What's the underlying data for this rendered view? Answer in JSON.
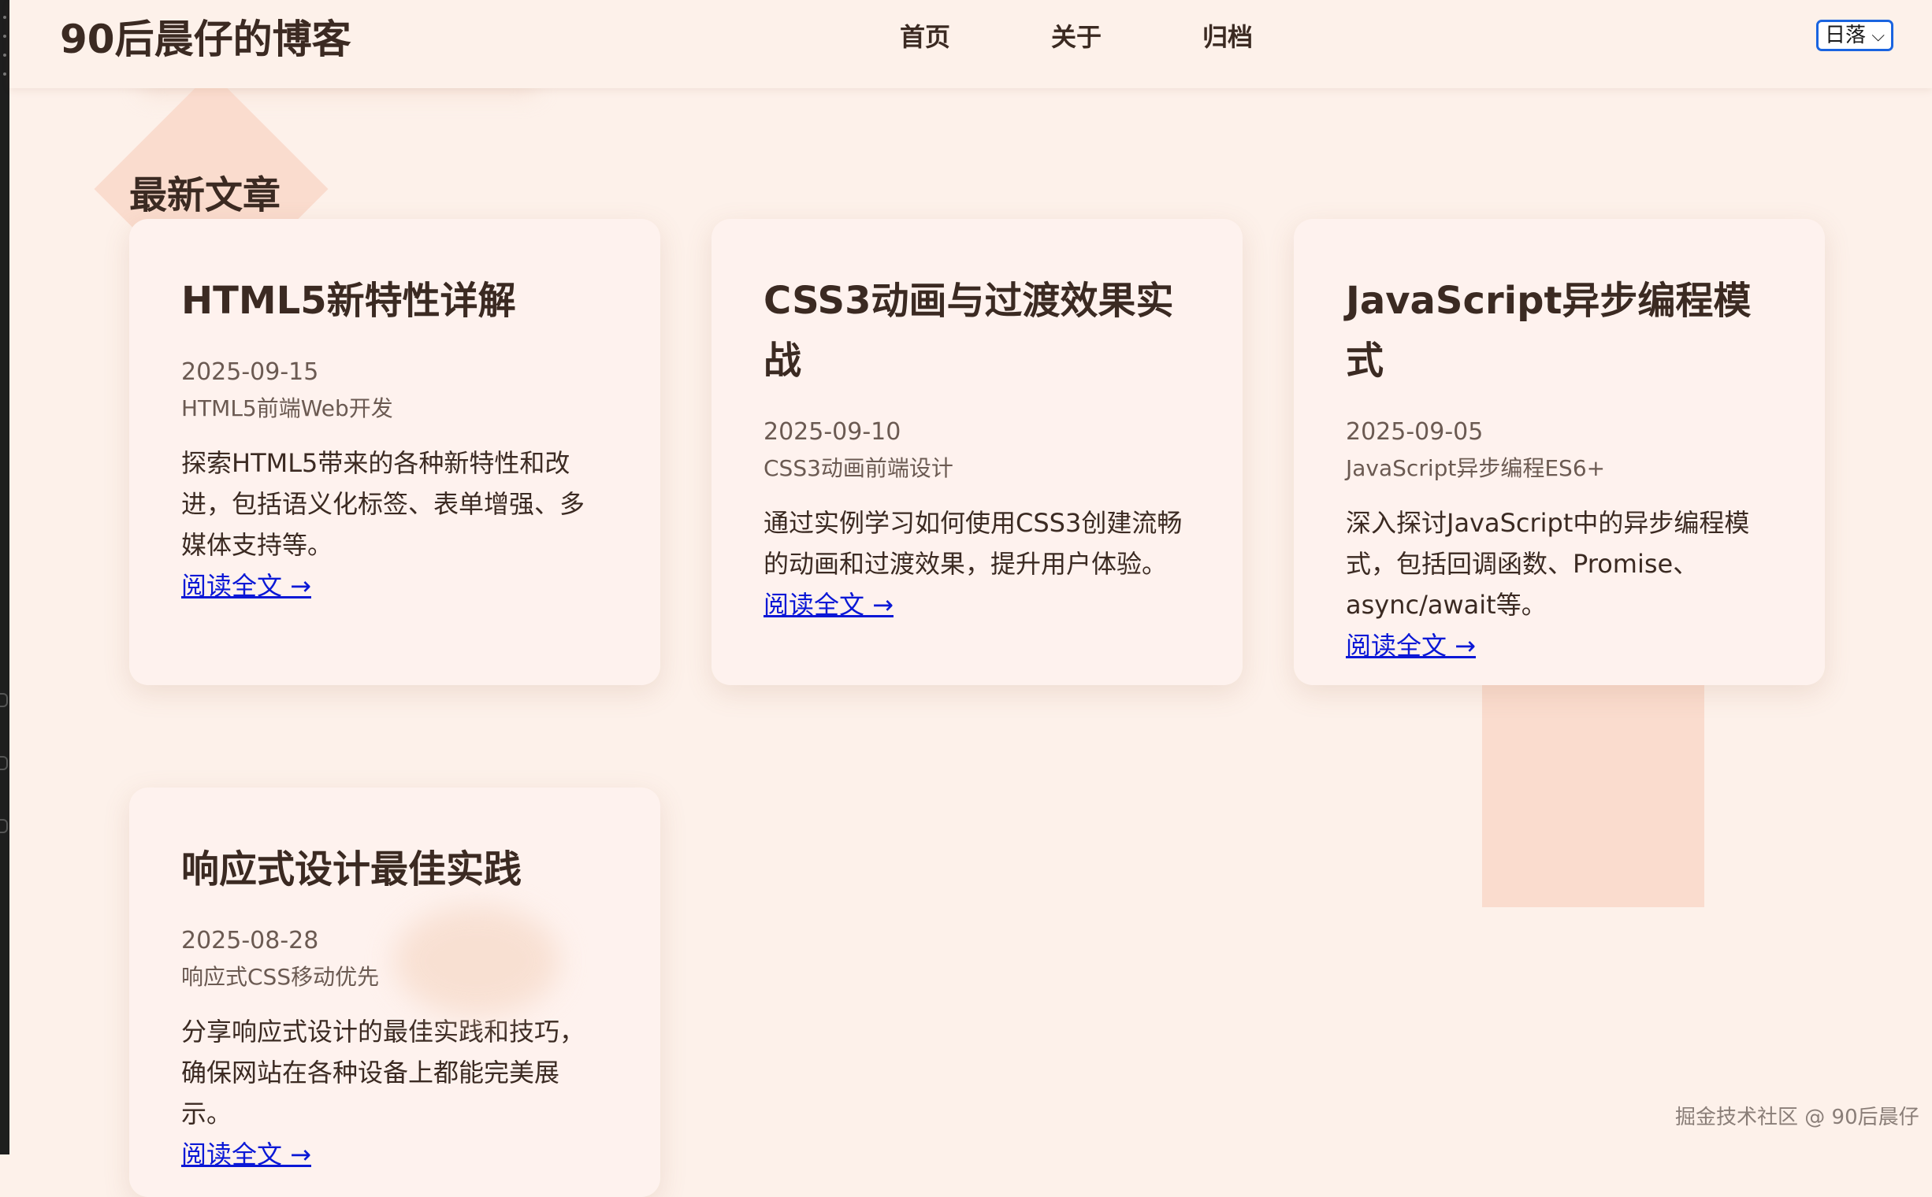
{
  "header": {
    "brand": "90后晨仔的博客",
    "nav": [
      "首页",
      "关于",
      "归档"
    ],
    "theme_selected": "日落"
  },
  "section_title": "最新文章",
  "posts": [
    {
      "title": "HTML5新特性详解",
      "date": "2025-09-15",
      "tags": "HTML5前端Web开发",
      "excerpt": "探索HTML5带来的各种新特性和改进，包括语义化标签、表单增强、多媒体支持等。",
      "read_more": "阅读全文 →"
    },
    {
      "title": "CSS3动画与过渡效果实战",
      "date": "2025-09-10",
      "tags": "CSS3动画前端设计",
      "excerpt": "通过实例学习如何使用CSS3创建流畅的动画和过渡效果，提升用户体验。",
      "read_more": "阅读全文 →"
    },
    {
      "title": "JavaScript异步编程模式",
      "date": "2025-09-05",
      "tags": "JavaScript异步编程ES6+",
      "excerpt": "深入探讨JavaScript中的异步编程模式，包括回调函数、Promise、async/await等。",
      "read_more": "阅读全文 →"
    },
    {
      "title": "响应式设计最佳实践",
      "date": "2025-08-28",
      "tags": "响应式CSS移动优先",
      "excerpt": "分享响应式设计的最佳实践和技巧，确保网站在各种设备上都能完美展示。",
      "read_more": "阅读全文 →"
    }
  ],
  "watermark": "掘金技术社区 @ 90后晨仔"
}
